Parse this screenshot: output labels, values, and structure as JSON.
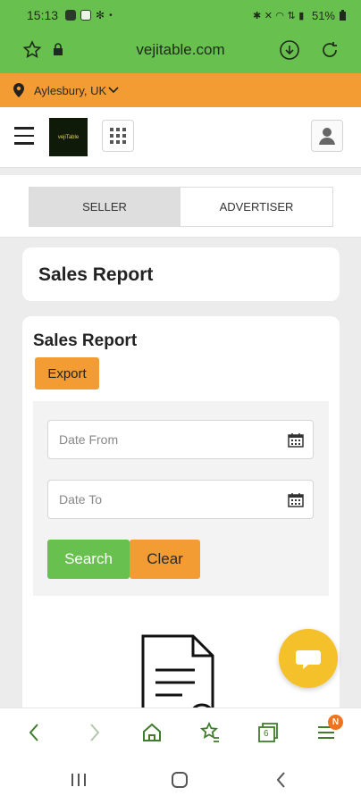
{
  "status_bar": {
    "time": "15:13",
    "battery": "51%"
  },
  "browser": {
    "url": "vejitable.com",
    "tab_count": "6",
    "menu_badge": "N"
  },
  "location": {
    "label": "Aylesbury, UK"
  },
  "header": {
    "logo_text": "vejiTable"
  },
  "tabs": [
    {
      "label": "SELLER",
      "active": true
    },
    {
      "label": "ADVERTISER",
      "active": false
    }
  ],
  "page_title": "Sales Report",
  "report": {
    "title": "Sales Report",
    "export_label": "Export",
    "date_from_placeholder": "Date From",
    "date_to_placeholder": "Date To",
    "search_label": "Search",
    "clear_label": "Clear"
  },
  "colors": {
    "brand_green": "#68c14e",
    "accent_orange": "#f39c33",
    "chat_yellow": "#f5c12a"
  }
}
